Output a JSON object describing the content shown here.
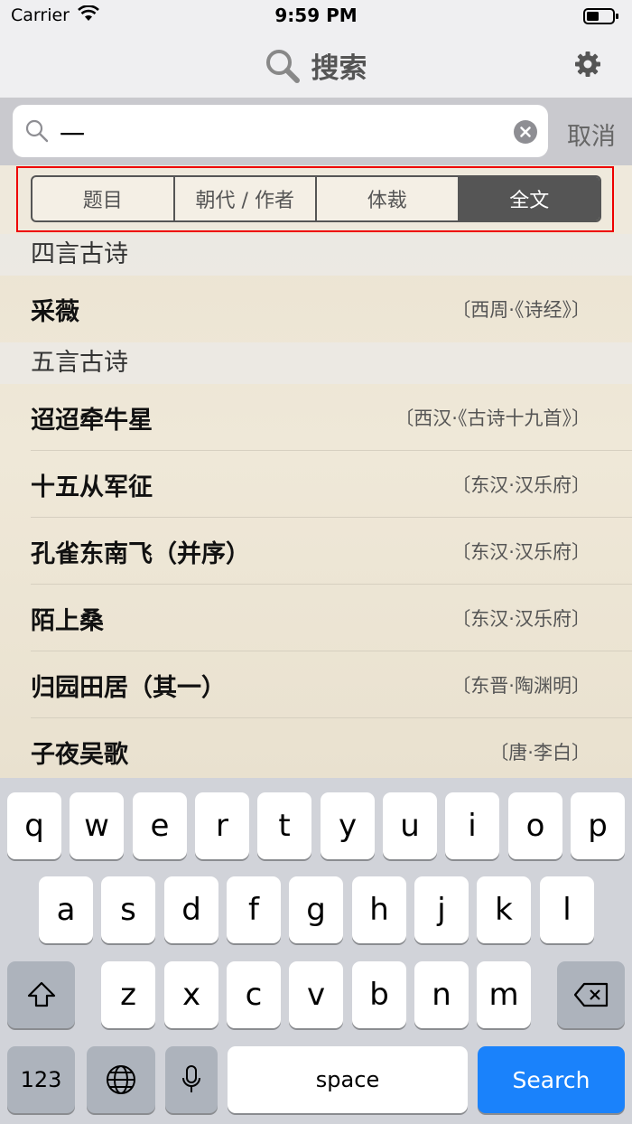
{
  "status": {
    "carrier": "Carrier",
    "time": "9:59 PM"
  },
  "navbar": {
    "title": "搜索"
  },
  "search": {
    "value": "一",
    "cancel": "取消"
  },
  "segments": [
    "题目",
    "朝代 / 作者",
    "体裁",
    "全文"
  ],
  "active_segment": "全文",
  "sections": [
    {
      "header": "四言古诗",
      "rows": [
        {
          "title": "采薇",
          "source": "〔西周·《诗经》〕"
        }
      ]
    },
    {
      "header": "五言古诗",
      "rows": [
        {
          "title": "迢迢牵牛星",
          "source": "〔西汉·《古诗十九首》〕"
        },
        {
          "title": "十五从军征",
          "source": "〔东汉·汉乐府〕"
        },
        {
          "title": "孔雀东南飞（并序）",
          "source": "〔东汉·汉乐府〕"
        },
        {
          "title": "陌上桑",
          "source": "〔东汉·汉乐府〕"
        },
        {
          "title": "归园田居（其一）",
          "source": "〔东晋·陶渊明〕"
        },
        {
          "title": "子夜吴歌",
          "source": "〔唐·李白〕"
        }
      ]
    }
  ],
  "keyboard": {
    "row1": [
      "q",
      "w",
      "e",
      "r",
      "t",
      "y",
      "u",
      "i",
      "o",
      "p"
    ],
    "row2": [
      "a",
      "s",
      "d",
      "f",
      "g",
      "h",
      "j",
      "k",
      "l"
    ],
    "row3": [
      "z",
      "x",
      "c",
      "v",
      "b",
      "n",
      "m"
    ],
    "num": "123",
    "space": "space",
    "search": "Search"
  },
  "colors": {
    "accent_blue": "#1a82fb",
    "segment_active": "#555555",
    "highlight_frame": "#ee0000"
  }
}
